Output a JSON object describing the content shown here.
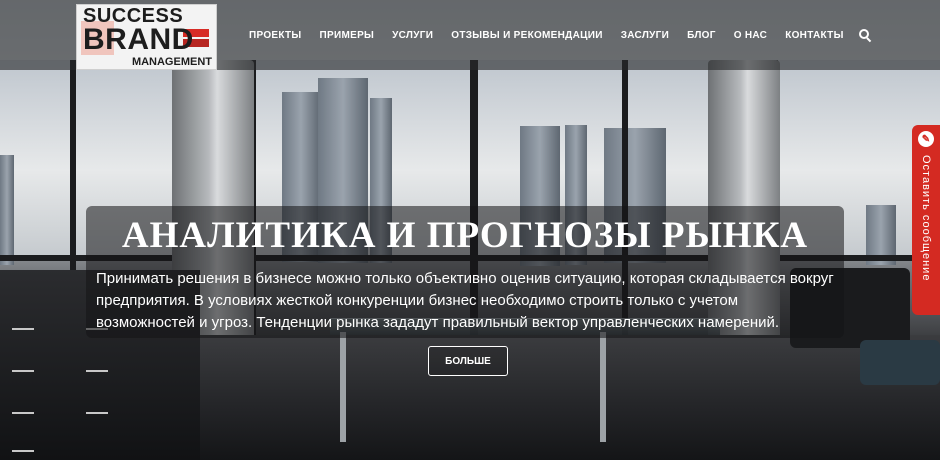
{
  "logo": {
    "line1": "SUCCESS",
    "line2": "BRAND",
    "line3": "MANAGEMENT"
  },
  "nav": {
    "items": [
      {
        "label": "ПРОЕКТЫ"
      },
      {
        "label": "ПРИМЕРЫ"
      },
      {
        "label": "УСЛУГИ"
      },
      {
        "label": "ОТЗЫВЫ И РЕКОМЕНДАЦИИ"
      },
      {
        "label": "ЗАСЛУГИ"
      },
      {
        "label": "БЛОГ"
      },
      {
        "label": "О НАС"
      },
      {
        "label": "КОНТАКТЫ"
      }
    ],
    "search_icon": "search-icon"
  },
  "hero": {
    "title": "АНАЛИТИКА И ПРОГНОЗЫ РЫНКА",
    "text": "Принимать решения в бизнесе можно только объективно оценив ситуацию, которая складывается вокруг предприятия. В условиях жесткой конкуренции бизнес необходимо строить только с учетом возможностей и угроз. Тенденции рынка зададут правильный вектор управленческих намерений.",
    "button_label": "БОЛЬШЕ"
  },
  "side_tab": {
    "label": "Оставить сообщение",
    "icon": "message-icon",
    "color": "#d42a22"
  }
}
